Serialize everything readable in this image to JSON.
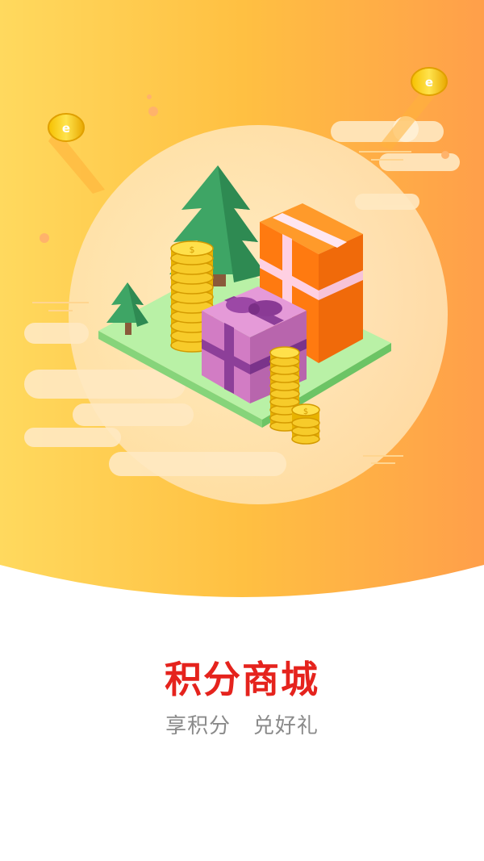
{
  "splash": {
    "title": "积分商城",
    "subtitle": "享积分   兑好礼"
  },
  "colors": {
    "hero_gradient_start": "#ffd45a",
    "hero_gradient_end": "#ff9f4a",
    "title": "#e5231d",
    "subtitle": "#8a8a8a",
    "background": "#ffffff"
  },
  "illustration": {
    "icons": [
      "gold-coin-icon",
      "gift-box-icon",
      "pine-tree-icon",
      "coin-stack-icon"
    ]
  }
}
